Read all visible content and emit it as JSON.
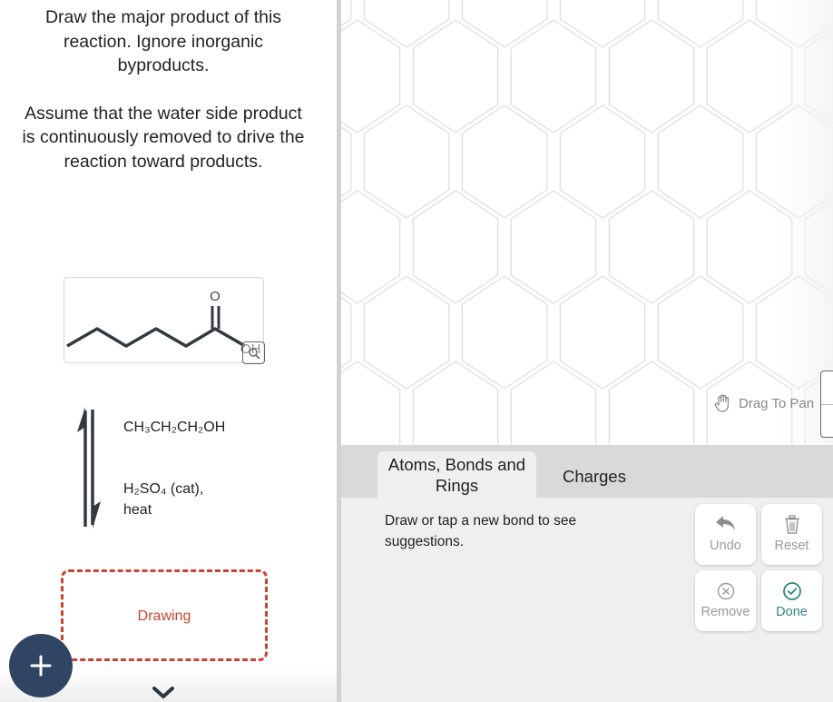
{
  "question": {
    "paragraphs": [
      "Draw the major product of this reaction. Ignore inorganic byproducts.",
      "Assume that the water side product is continuously removed to drive the reaction toward products."
    ]
  },
  "reactant": {
    "name": "hexanoic acid",
    "atom_labels": {
      "carbonyl_o": "O",
      "hydroxyl": "OH"
    },
    "zoom_icon": "magnify-icon"
  },
  "reaction": {
    "arrow": "equilibrium-arrows",
    "condition_1": "CH₃CH₂CH₂OH",
    "condition_2": "H₂SO₄ (cat), heat"
  },
  "answer": {
    "placeholder_label": "Drawing"
  },
  "canvas": {
    "drag_hint": "Drag To Pan",
    "grid": "hexagon"
  },
  "tabs": [
    {
      "label": "Atoms, Bonds and Rings",
      "active": true
    },
    {
      "label": "Charges",
      "active": false
    }
  ],
  "tool_hint": "Draw or tap a new bond to see suggestions.",
  "actions": {
    "undo": "Undo",
    "reset": "Reset",
    "remove": "Remove",
    "done": "Done"
  },
  "colors": {
    "accent_drawing": "#c8452f",
    "fab": "#2f4563",
    "done": "#2e8a78"
  }
}
